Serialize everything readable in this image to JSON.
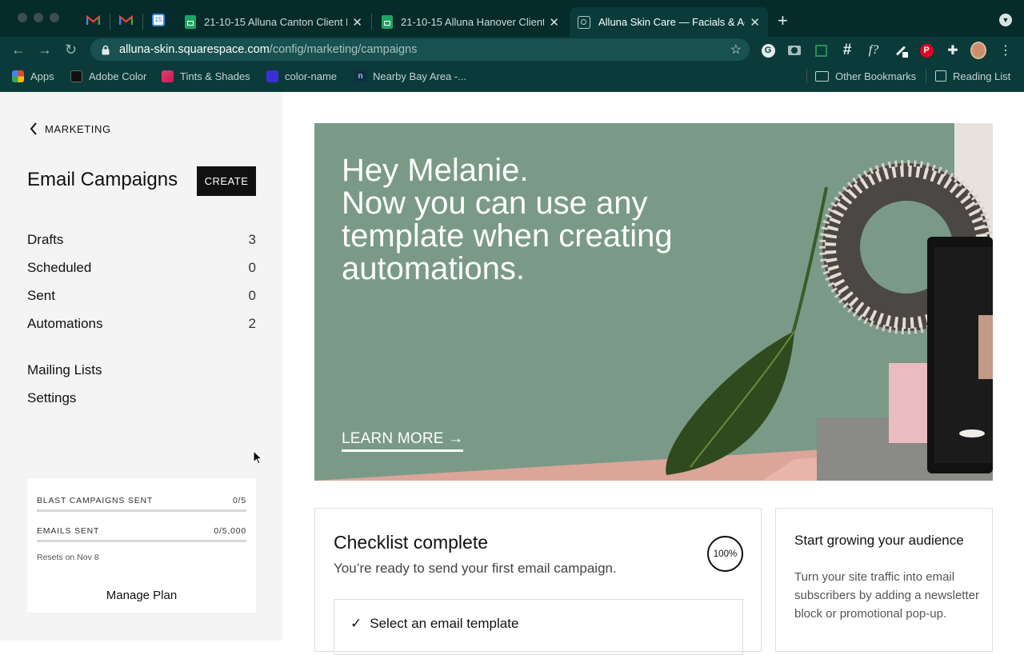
{
  "browser": {
    "tabs": [
      {
        "title": "21-10-15 Alluna Canton Client P",
        "icon": "sheets-icon"
      },
      {
        "title": "21-10-15 Alluna Hanover Client",
        "icon": "sheets-icon"
      },
      {
        "title": "Alluna Skin Care — Facials & Ac",
        "icon": "squarespace-icon"
      }
    ],
    "url_domain": "alluna-skin.squarespace.com",
    "url_path": "/config/marketing/campaigns",
    "calendar_day": "15",
    "bookmarks": [
      {
        "label": "Apps",
        "icon": "apps-grid-icon"
      },
      {
        "label": "Adobe Color",
        "icon": "adobe-color-icon"
      },
      {
        "label": "Tints & Shades",
        "icon": "tints-icon"
      },
      {
        "label": "color-name",
        "icon": "color-name-icon"
      },
      {
        "label": "Nearby Bay Area -...",
        "icon": "nextdoor-icon"
      }
    ],
    "other_bookmarks": "Other Bookmarks",
    "reading_list": "Reading List",
    "ext_fx": "f?"
  },
  "sidebar": {
    "back_label": "MARKETING",
    "title": "Email Campaigns",
    "create_label": "CREATE",
    "nav": [
      {
        "label": "Drafts",
        "count": "3"
      },
      {
        "label": "Scheduled",
        "count": "0"
      },
      {
        "label": "Sent",
        "count": "0"
      },
      {
        "label": "Automations",
        "count": "2"
      }
    ],
    "links": [
      {
        "label": "Mailing Lists"
      },
      {
        "label": "Settings"
      }
    ],
    "plan": {
      "blast_label": "BLAST CAMPAIGNS SENT",
      "blast_value": "0/5",
      "blast_progress": 0,
      "emails_label": "EMAILS SENT",
      "emails_value": "0/5,000",
      "emails_progress": 0,
      "resets": "Resets on Nov 8",
      "manage_label": "Manage Plan"
    }
  },
  "banner": {
    "line1": "Hey Melanie.",
    "line2": "Now you can use any template when creating automations.",
    "learn_more": "LEARN MORE →"
  },
  "checklist": {
    "title": "Checklist complete",
    "subtitle": "You’re ready to send your first email campaign.",
    "percent": "100%",
    "step": "Select an email template"
  },
  "audience": {
    "title": "Start growing your audience",
    "body": "Turn your site traffic into email subscribers by adding a newsletter block or promotional pop-up."
  }
}
